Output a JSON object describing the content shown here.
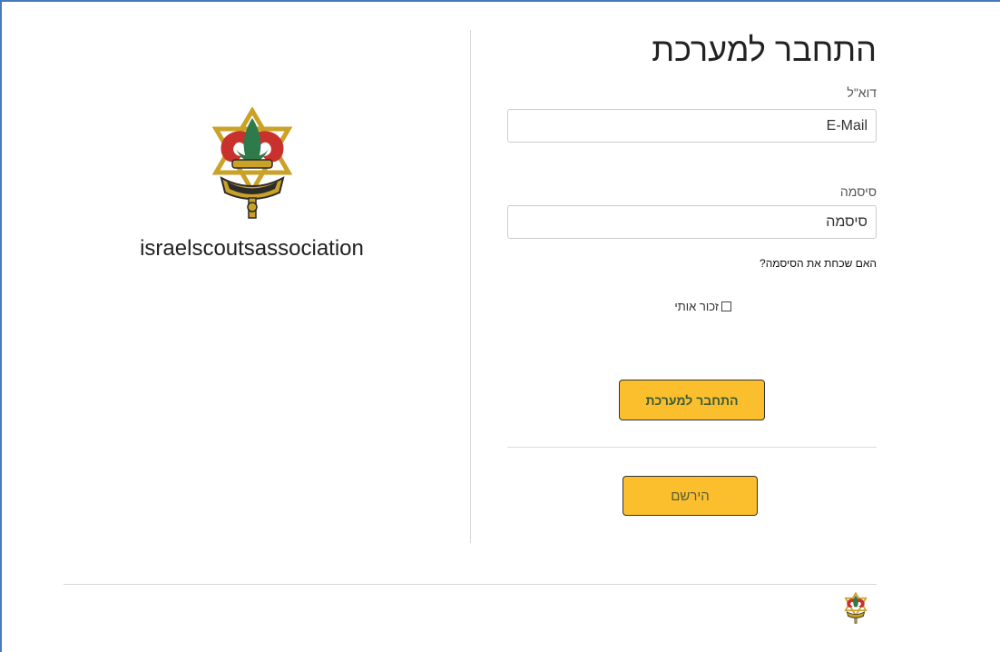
{
  "brand": {
    "name": "israelscoutsassociation",
    "logo_icon": "scouts-emblem-icon",
    "logo_motto": "היה נכון",
    "colors": {
      "gold": "#c9a227",
      "red": "#c8312c",
      "green": "#2f7a4a",
      "dark": "#2b2b2b"
    }
  },
  "login": {
    "title": "התחבר למערכת",
    "email": {
      "label": "דוא\"ל",
      "placeholder": "E-Mail",
      "value": ""
    },
    "password": {
      "label": "סיסמה",
      "placeholder": "סיסמה",
      "value": ""
    },
    "forgot_password": "האם שכחת את הסיסמה?",
    "remember_me": {
      "label": "זכור אותי",
      "checked": false
    },
    "submit_label": "התחבר למערכת",
    "register_label": "הירשם"
  },
  "colors": {
    "accent": "#fbbf2d",
    "frame": "#4a78b8"
  }
}
